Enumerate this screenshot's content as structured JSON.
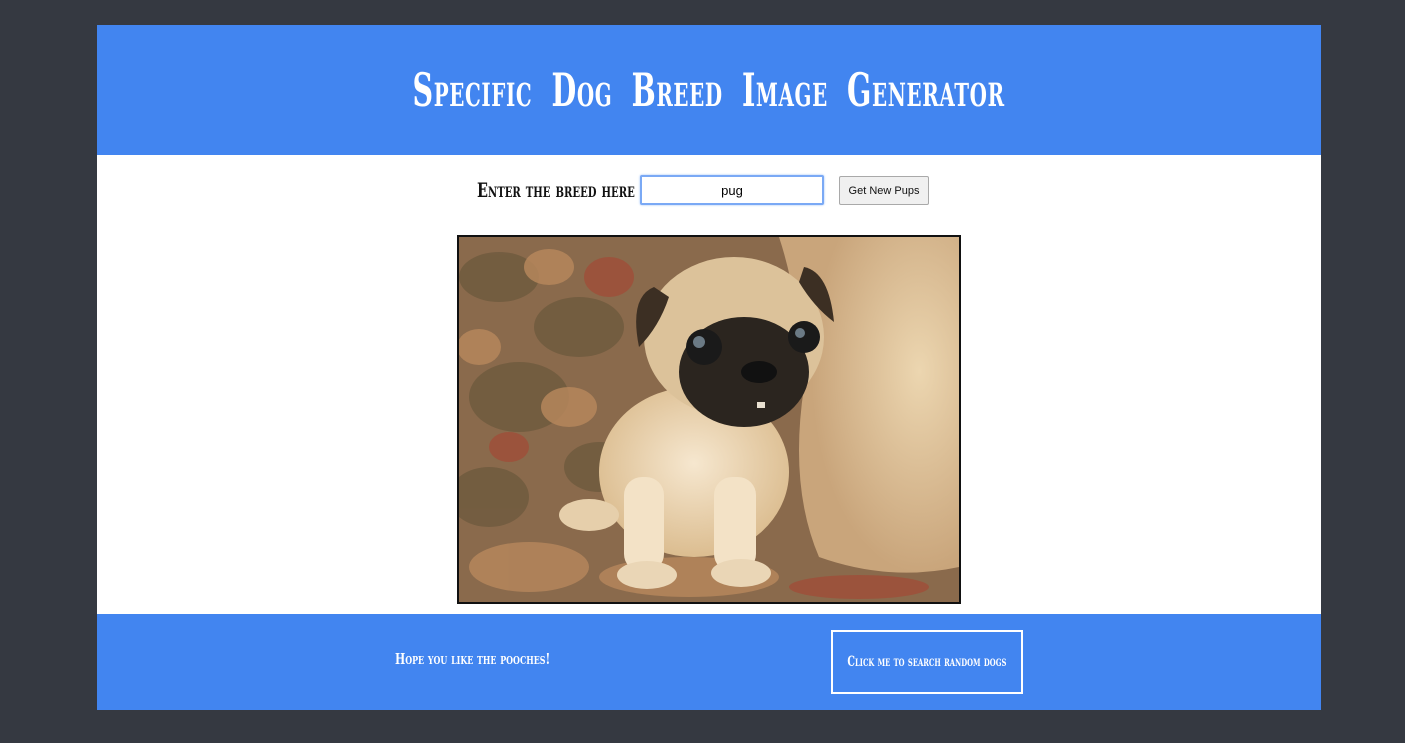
{
  "header": {
    "title": "Specific Dog Breed Image Generator"
  },
  "search": {
    "label": "Enter the breed here",
    "value": "pug",
    "button_label": "Get New Pups"
  },
  "image": {
    "alt": "pug"
  },
  "footer": {
    "message": "Hope you like the pooches!",
    "random_button_label": "Click me to search random dogs"
  },
  "colors": {
    "background": "#353941",
    "brand_blue": "#4285f0",
    "panel": "#ffffff"
  }
}
